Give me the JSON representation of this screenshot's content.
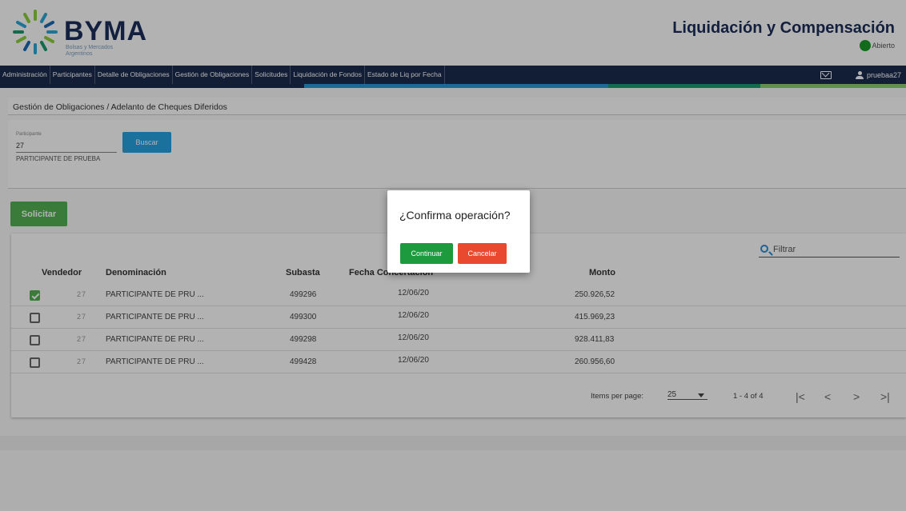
{
  "header": {
    "brand": "BYMA",
    "brand_sub": "Bolsas y Mercados Argentinos",
    "app_title": "Liquidación y Compensación",
    "status": "Abierto",
    "status_color": "#1a9a2a"
  },
  "nav": {
    "items": [
      "Administración",
      "Participantes",
      "Detalle de Obligaciones",
      "Gestión de Obligaciones",
      "Solicitudes",
      "Liquidación de Fondos",
      "Estado de Liq por Fecha"
    ],
    "user": "pruebaa27",
    "stripe_colors": [
      "#1b2c4e",
      "#2a9ad6",
      "#1a9a6a",
      "#8ccf6a"
    ]
  },
  "breadcrumb": "Gestión de Obligaciones / Adelanto de Cheques Diferidos",
  "search": {
    "label": "Participante",
    "value": "27",
    "button": "Buscar",
    "participant_name": "PARTICIPANTE DE PRUEBA"
  },
  "solicitar_label": "Solicitar",
  "table": {
    "filter_placeholder": "Filtrar",
    "headers": {
      "vendedor": "Vendedor",
      "denominacion": "Denominación",
      "subasta": "Subasta",
      "fecha": "Fecha Concertación",
      "monto": "Monto"
    },
    "rows": [
      {
        "checked": true,
        "vendedor": "27",
        "denominacion": "PARTICIPANTE DE PRU ...",
        "subasta": "499296",
        "fecha": "12/06/20",
        "monto": "250.926,52"
      },
      {
        "checked": false,
        "vendedor": "27",
        "denominacion": "PARTICIPANTE DE PRU ...",
        "subasta": "499300",
        "fecha": "12/06/20",
        "monto": "415.969,23"
      },
      {
        "checked": false,
        "vendedor": "27",
        "denominacion": "PARTICIPANTE DE PRU ...",
        "subasta": "499298",
        "fecha": "12/06/20",
        "monto": "928.411,83"
      },
      {
        "checked": false,
        "vendedor": "27",
        "denominacion": "PARTICIPANTE DE PRU ...",
        "subasta": "499428",
        "fecha": "12/06/20",
        "monto": "260.956,60"
      }
    ],
    "paginator": {
      "items_per_page_label": "Items per page:",
      "page_size": "25",
      "range": "1 - 4 of 4"
    }
  },
  "dialog": {
    "title": "¿Confirma operación?",
    "continue": "Continuar",
    "cancel": "Cancelar"
  }
}
